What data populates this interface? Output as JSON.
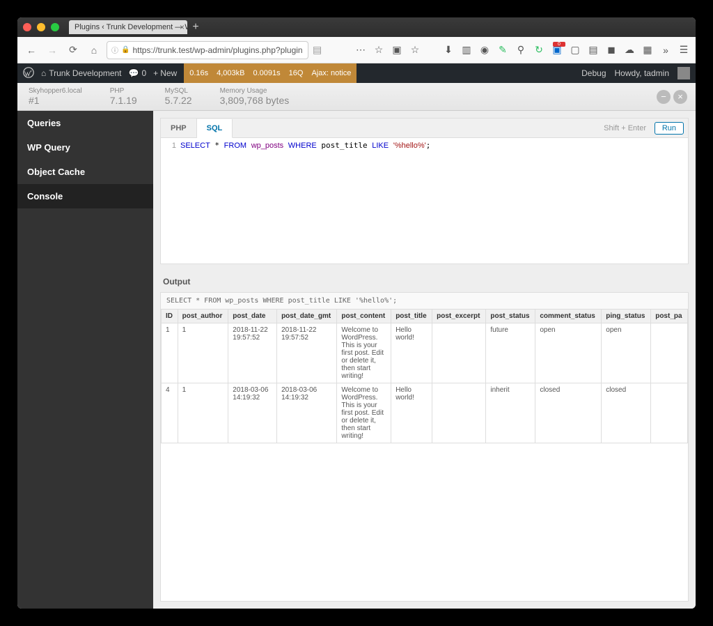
{
  "browser": {
    "tab_title": "Plugins ‹ Trunk Development — Wo",
    "url": "https://trunk.test/wp-admin/plugins.php?plugin"
  },
  "wpbar": {
    "site": "Trunk Development",
    "comments": "0",
    "new": "New",
    "debug": "Debug",
    "howdy": "Howdy, tadmin"
  },
  "stats": {
    "time": "0.16s",
    "size": "4,003kB",
    "qtime": "0.0091s",
    "queries": "16Q",
    "ajax": "Ajax: notice"
  },
  "info": {
    "host_lbl": "Skyhopper6.local",
    "host_val": "#1",
    "php_lbl": "PHP",
    "php_val": "7.1.19",
    "mysql_lbl": "MySQL",
    "mysql_val": "5.7.22",
    "mem_lbl": "Memory Usage",
    "mem_val": "3,809,768 bytes"
  },
  "sidebar": {
    "items": [
      "Queries",
      "WP Query",
      "Object Cache",
      "Console"
    ]
  },
  "editor": {
    "tab_php": "PHP",
    "tab_sql": "SQL",
    "hint": "Shift + Enter",
    "run": "Run",
    "sql": "SELECT * FROM wp_posts WHERE post_title LIKE '%hello%';"
  },
  "output": {
    "label": "Output",
    "query": "SELECT * FROM wp_posts WHERE post_title LIKE '%hello%';",
    "cols": [
      "ID",
      "post_author",
      "post_date",
      "post_date_gmt",
      "post_content",
      "post_title",
      "post_excerpt",
      "post_status",
      "comment_status",
      "ping_status",
      "post_pa"
    ],
    "rows": [
      {
        "ID": "1",
        "post_author": "1",
        "post_date": "2018-11-22 19:57:52",
        "post_date_gmt": "2018-11-22 19:57:52",
        "post_content": "Welcome to WordPress. This is your first post. Edit or delete it, then start writing!",
        "post_title": "Hello world!",
        "post_excerpt": "",
        "post_status": "future",
        "comment_status": "open",
        "ping_status": "open",
        "post_pa": ""
      },
      {
        "ID": "4",
        "post_author": "1",
        "post_date": "2018-03-06 14:19:32",
        "post_date_gmt": "2018-03-06 14:19:32",
        "post_content": "Welcome to WordPress. This is your first post. Edit or delete it, then start writing!",
        "post_title": "Hello world!",
        "post_excerpt": "",
        "post_status": "inherit",
        "comment_status": "closed",
        "ping_status": "closed",
        "post_pa": ""
      }
    ]
  }
}
